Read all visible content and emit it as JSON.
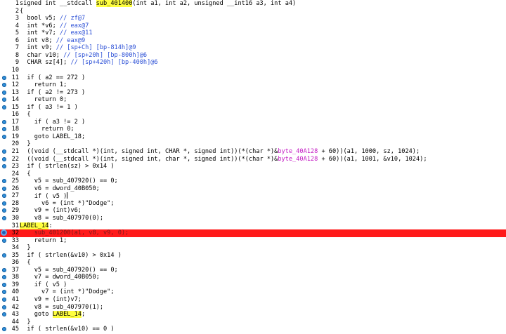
{
  "lines": [
    {
      "n": "1",
      "bp": false,
      "tokens": [
        {
          "t": "signed int __stdcall "
        },
        {
          "t": "sub_401400",
          "c": "hl"
        },
        {
          "t": "(int a1, int a2, unsigned __int16 a3, int a4)"
        }
      ]
    },
    {
      "n": "2",
      "bp": false,
      "tokens": [
        {
          "t": "{"
        }
      ]
    },
    {
      "n": "3",
      "bp": false,
      "tokens": [
        {
          "t": "  bool v5; "
        },
        {
          "t": "// zf@7",
          "c": "comment"
        }
      ]
    },
    {
      "n": "4",
      "bp": false,
      "tokens": [
        {
          "t": "  int *v6; "
        },
        {
          "t": "// eax@7",
          "c": "comment"
        }
      ]
    },
    {
      "n": "5",
      "bp": false,
      "tokens": [
        {
          "t": "  int *v7; "
        },
        {
          "t": "// eax@11",
          "c": "comment"
        }
      ]
    },
    {
      "n": "6",
      "bp": false,
      "tokens": [
        {
          "t": "  int v8; "
        },
        {
          "t": "// eax@9",
          "c": "comment"
        }
      ]
    },
    {
      "n": "7",
      "bp": false,
      "tokens": [
        {
          "t": "  int v9; "
        },
        {
          "t": "// [sp+Ch] [bp-814h]@9",
          "c": "comment"
        }
      ]
    },
    {
      "n": "8",
      "bp": false,
      "tokens": [
        {
          "t": "  char v10; "
        },
        {
          "t": "// [sp+20h] [bp-800h]@6",
          "c": "comment"
        }
      ]
    },
    {
      "n": "9",
      "bp": false,
      "tokens": [
        {
          "t": "  CHAR sz[4]; "
        },
        {
          "t": "// [sp+420h] [bp-400h]@6",
          "c": "comment"
        }
      ]
    },
    {
      "n": "10",
      "bp": false,
      "tokens": [
        {
          "t": ""
        }
      ]
    },
    {
      "n": "11",
      "bp": true,
      "tokens": [
        {
          "t": "  if ( a2 == 272 )"
        }
      ]
    },
    {
      "n": "12",
      "bp": true,
      "tokens": [
        {
          "t": "    return 1;"
        }
      ]
    },
    {
      "n": "13",
      "bp": true,
      "tokens": [
        {
          "t": "  if ( a2 != 273 )"
        }
      ]
    },
    {
      "n": "14",
      "bp": true,
      "tokens": [
        {
          "t": "    return 0;"
        }
      ]
    },
    {
      "n": "15",
      "bp": true,
      "tokens": [
        {
          "t": "  if ( a3 != 1 )"
        }
      ]
    },
    {
      "n": "16",
      "bp": false,
      "tokens": [
        {
          "t": "  {"
        }
      ]
    },
    {
      "n": "17",
      "bp": true,
      "tokens": [
        {
          "t": "    if ( a3 != 2 )"
        }
      ]
    },
    {
      "n": "18",
      "bp": true,
      "tokens": [
        {
          "t": "      return 0;"
        }
      ]
    },
    {
      "n": "19",
      "bp": true,
      "tokens": [
        {
          "t": "    goto LABEL_18;"
        }
      ]
    },
    {
      "n": "20",
      "bp": false,
      "tokens": [
        {
          "t": "  }"
        }
      ]
    },
    {
      "n": "21",
      "bp": true,
      "tokens": [
        {
          "t": "  ((void (__stdcall *)(int, signed int, CHAR *, signed int))(*(char *)&"
        },
        {
          "t": "byte_40A128",
          "c": "magenta"
        },
        {
          "t": " + 60))(a1, 1000, sz, 1024);"
        }
      ]
    },
    {
      "n": "22",
      "bp": true,
      "tokens": [
        {
          "t": "  ((void (__stdcall *)(int, signed int, char *, signed int))(*(char *)&"
        },
        {
          "t": "byte_40A128",
          "c": "magenta"
        },
        {
          "t": " + 60))(a1, 1001, &v10, 1024);"
        }
      ]
    },
    {
      "n": "23",
      "bp": true,
      "tokens": [
        {
          "t": "  if ( strlen(sz) > 0x14 )"
        }
      ]
    },
    {
      "n": "24",
      "bp": false,
      "tokens": [
        {
          "t": "  {"
        }
      ]
    },
    {
      "n": "25",
      "bp": true,
      "tokens": [
        {
          "t": "    v5 = sub_407920() == 0;"
        }
      ]
    },
    {
      "n": "26",
      "bp": true,
      "tokens": [
        {
          "t": "    v6 = dword_40B050;"
        }
      ]
    },
    {
      "n": "27",
      "bp": true,
      "tokens": [
        {
          "t": "    if ( v5 )"
        }
      ],
      "cursor": true
    },
    {
      "n": "28",
      "bp": true,
      "tokens": [
        {
          "t": "      v6 = (int *)\"Dodge\";"
        }
      ]
    },
    {
      "n": "29",
      "bp": true,
      "tokens": [
        {
          "t": "    v9 = (int)v6;"
        }
      ]
    },
    {
      "n": "30",
      "bp": true,
      "tokens": [
        {
          "t": "    v8 = sub_407970(0);"
        }
      ]
    },
    {
      "n": "31",
      "bp": false,
      "tokens": [
        {
          "t": "LABEL_14",
          "c": "hl"
        },
        {
          "t": ":"
        }
      ]
    },
    {
      "n": "32",
      "bp": true,
      "highlight": true,
      "tokens": [
        {
          "t": "    "
        },
        {
          "t": "sub_401200(a1, v8, v9, 0);",
          "c": "red"
        }
      ]
    },
    {
      "n": "33",
      "bp": true,
      "tokens": [
        {
          "t": "    return 1;"
        }
      ]
    },
    {
      "n": "34",
      "bp": false,
      "tokens": [
        {
          "t": "  }"
        }
      ]
    },
    {
      "n": "35",
      "bp": true,
      "tokens": [
        {
          "t": "  if ( strlen(&v10) > 0x14 )"
        }
      ]
    },
    {
      "n": "36",
      "bp": false,
      "tokens": [
        {
          "t": "  {"
        }
      ]
    },
    {
      "n": "37",
      "bp": true,
      "tokens": [
        {
          "t": "    v5 = sub_407920() == 0;"
        }
      ]
    },
    {
      "n": "38",
      "bp": true,
      "tokens": [
        {
          "t": "    v7 = dword_40B050;"
        }
      ]
    },
    {
      "n": "39",
      "bp": true,
      "tokens": [
        {
          "t": "    if ( v5 )"
        }
      ]
    },
    {
      "n": "40",
      "bp": true,
      "tokens": [
        {
          "t": "      v7 = (int *)\"Dodge\";"
        }
      ]
    },
    {
      "n": "41",
      "bp": true,
      "tokens": [
        {
          "t": "    v9 = (int)v7;"
        }
      ]
    },
    {
      "n": "42",
      "bp": true,
      "tokens": [
        {
          "t": "    v8 = sub_407970(1);"
        }
      ]
    },
    {
      "n": "43",
      "bp": true,
      "tokens": [
        {
          "t": "    goto "
        },
        {
          "t": "LABEL_14",
          "c": "hl"
        },
        {
          "t": ";"
        }
      ]
    },
    {
      "n": "44",
      "bp": false,
      "tokens": [
        {
          "t": "  }"
        }
      ]
    },
    {
      "n": "45",
      "bp": true,
      "tokens": [
        {
          "t": "  if ( strlen(&v10) == 0 )"
        }
      ]
    }
  ],
  "current_line": "32",
  "colors": {
    "comment": "#2b4fd6",
    "magenta": "#c218c2",
    "highlight_yellow": "#ffff40",
    "current_line_red": "#ff1a1a",
    "breakpoint_dot": "#2f8fd8"
  },
  "icons": {
    "breakpoint": "breakpoint-dot-icon",
    "current": "current-instruction-icon"
  }
}
